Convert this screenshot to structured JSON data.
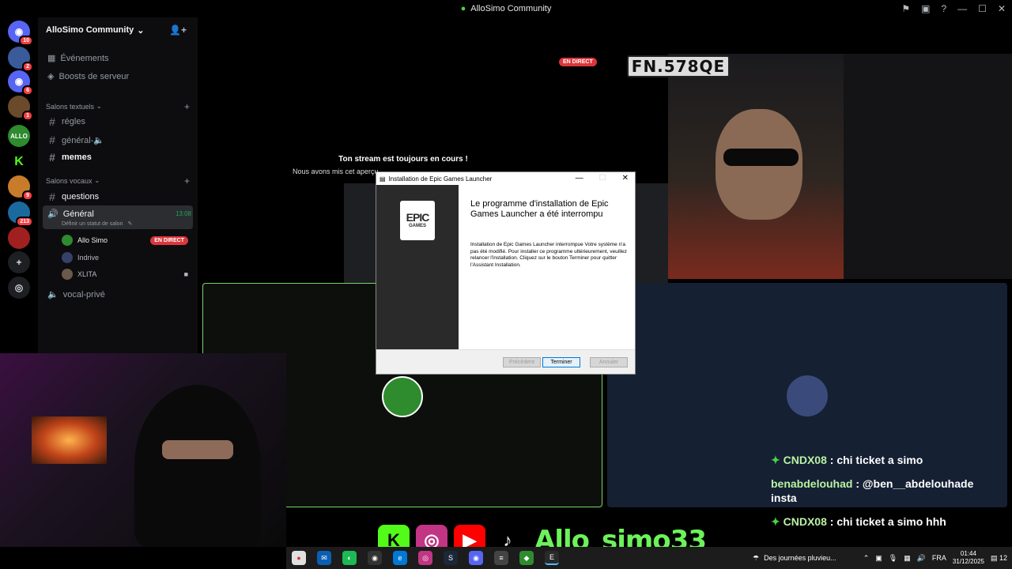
{
  "window": {
    "title": "AlloSimo Community"
  },
  "servers": [
    {
      "name": "discord-home",
      "badge": "10",
      "color": "#5865f2"
    },
    {
      "name": "server-avatar-1",
      "badge": "2",
      "color": "#3a5a9a"
    },
    {
      "name": "discord-server",
      "badge": "6",
      "color": "#5865f2"
    },
    {
      "name": "server-avatar-2",
      "badge": "1",
      "color": "#6a4a2a"
    },
    {
      "name": "allo-server",
      "badge": "",
      "color": "#2e8b2e"
    },
    {
      "name": "kick-server",
      "badge": "",
      "color": "#53fc18"
    },
    {
      "name": "server-avatar-3",
      "badge": "9",
      "color": "#c87c2a"
    },
    {
      "name": "server-avatar-4",
      "badge": "213",
      "color": "#1a6aa0"
    },
    {
      "name": "server-avatar-5",
      "badge": "",
      "color": "#a02020"
    }
  ],
  "guild": {
    "name": "AlloSimo Community"
  },
  "channels": {
    "events": "Événements",
    "boosts": "Boosts de serveur",
    "text_category": "Salons textuels",
    "text": [
      "régles",
      "général-🔈",
      "memes"
    ],
    "voice_category": "Salons vocaux",
    "questions": "questions",
    "voice_active": {
      "name": "Général",
      "time": "13:08",
      "status": "Définir un statut de salon"
    },
    "voice_users": [
      {
        "name": "Allo Simo",
        "live": "EN DIRECT"
      },
      {
        "name": "Indrive",
        "live": ""
      },
      {
        "name": "XLITA",
        "live": ""
      }
    ],
    "vocal_prive": "vocal-privé"
  },
  "stream": {
    "live_tag": "EN DIRECT",
    "plate": "FN.578QE",
    "msg_title": "Ton stream est toujours en cours !",
    "msg_body": "Nous avons mis cet aperçu"
  },
  "dialog": {
    "title": "Installation de Epic Games Launcher",
    "logo_top": "EPIC",
    "logo_bottom": "GAMES",
    "heading": "Le programme d'installation de Epic Games Launcher a été interrompu",
    "body": "Installation de Epic Games Launcher interrompue Votre système n'a pas été modifié. Pour installer ce programme ultérieurement, veuillez relancer l'installation. Cliquez sur le bouton Terminer pour quitter l'Assistant Installation.",
    "btn_prev": "Précédent",
    "btn_finish": "Terminer",
    "btn_cancel": "Annuler"
  },
  "chat": [
    {
      "user": "CNDX08",
      "msg": " : chi ticket a simo",
      "star": true
    },
    {
      "user": "benabdelouhad",
      "msg": " : @ben__abdelouhade insta",
      "star": false
    },
    {
      "user": "CNDX08",
      "msg": " : chi ticket a simo hhh",
      "star": true
    }
  ],
  "overlay": {
    "handle": "Allo_simo33"
  },
  "taskbar": {
    "weather": "Des journées pluvieu...",
    "lang": "FRA",
    "time": "01:44",
    "date": "31/12/2025",
    "notif": "12"
  },
  "colors": {
    "accent_live": "#da373c",
    "discord_bg": "#0d0d0f",
    "green_border": "#7bd46a"
  }
}
